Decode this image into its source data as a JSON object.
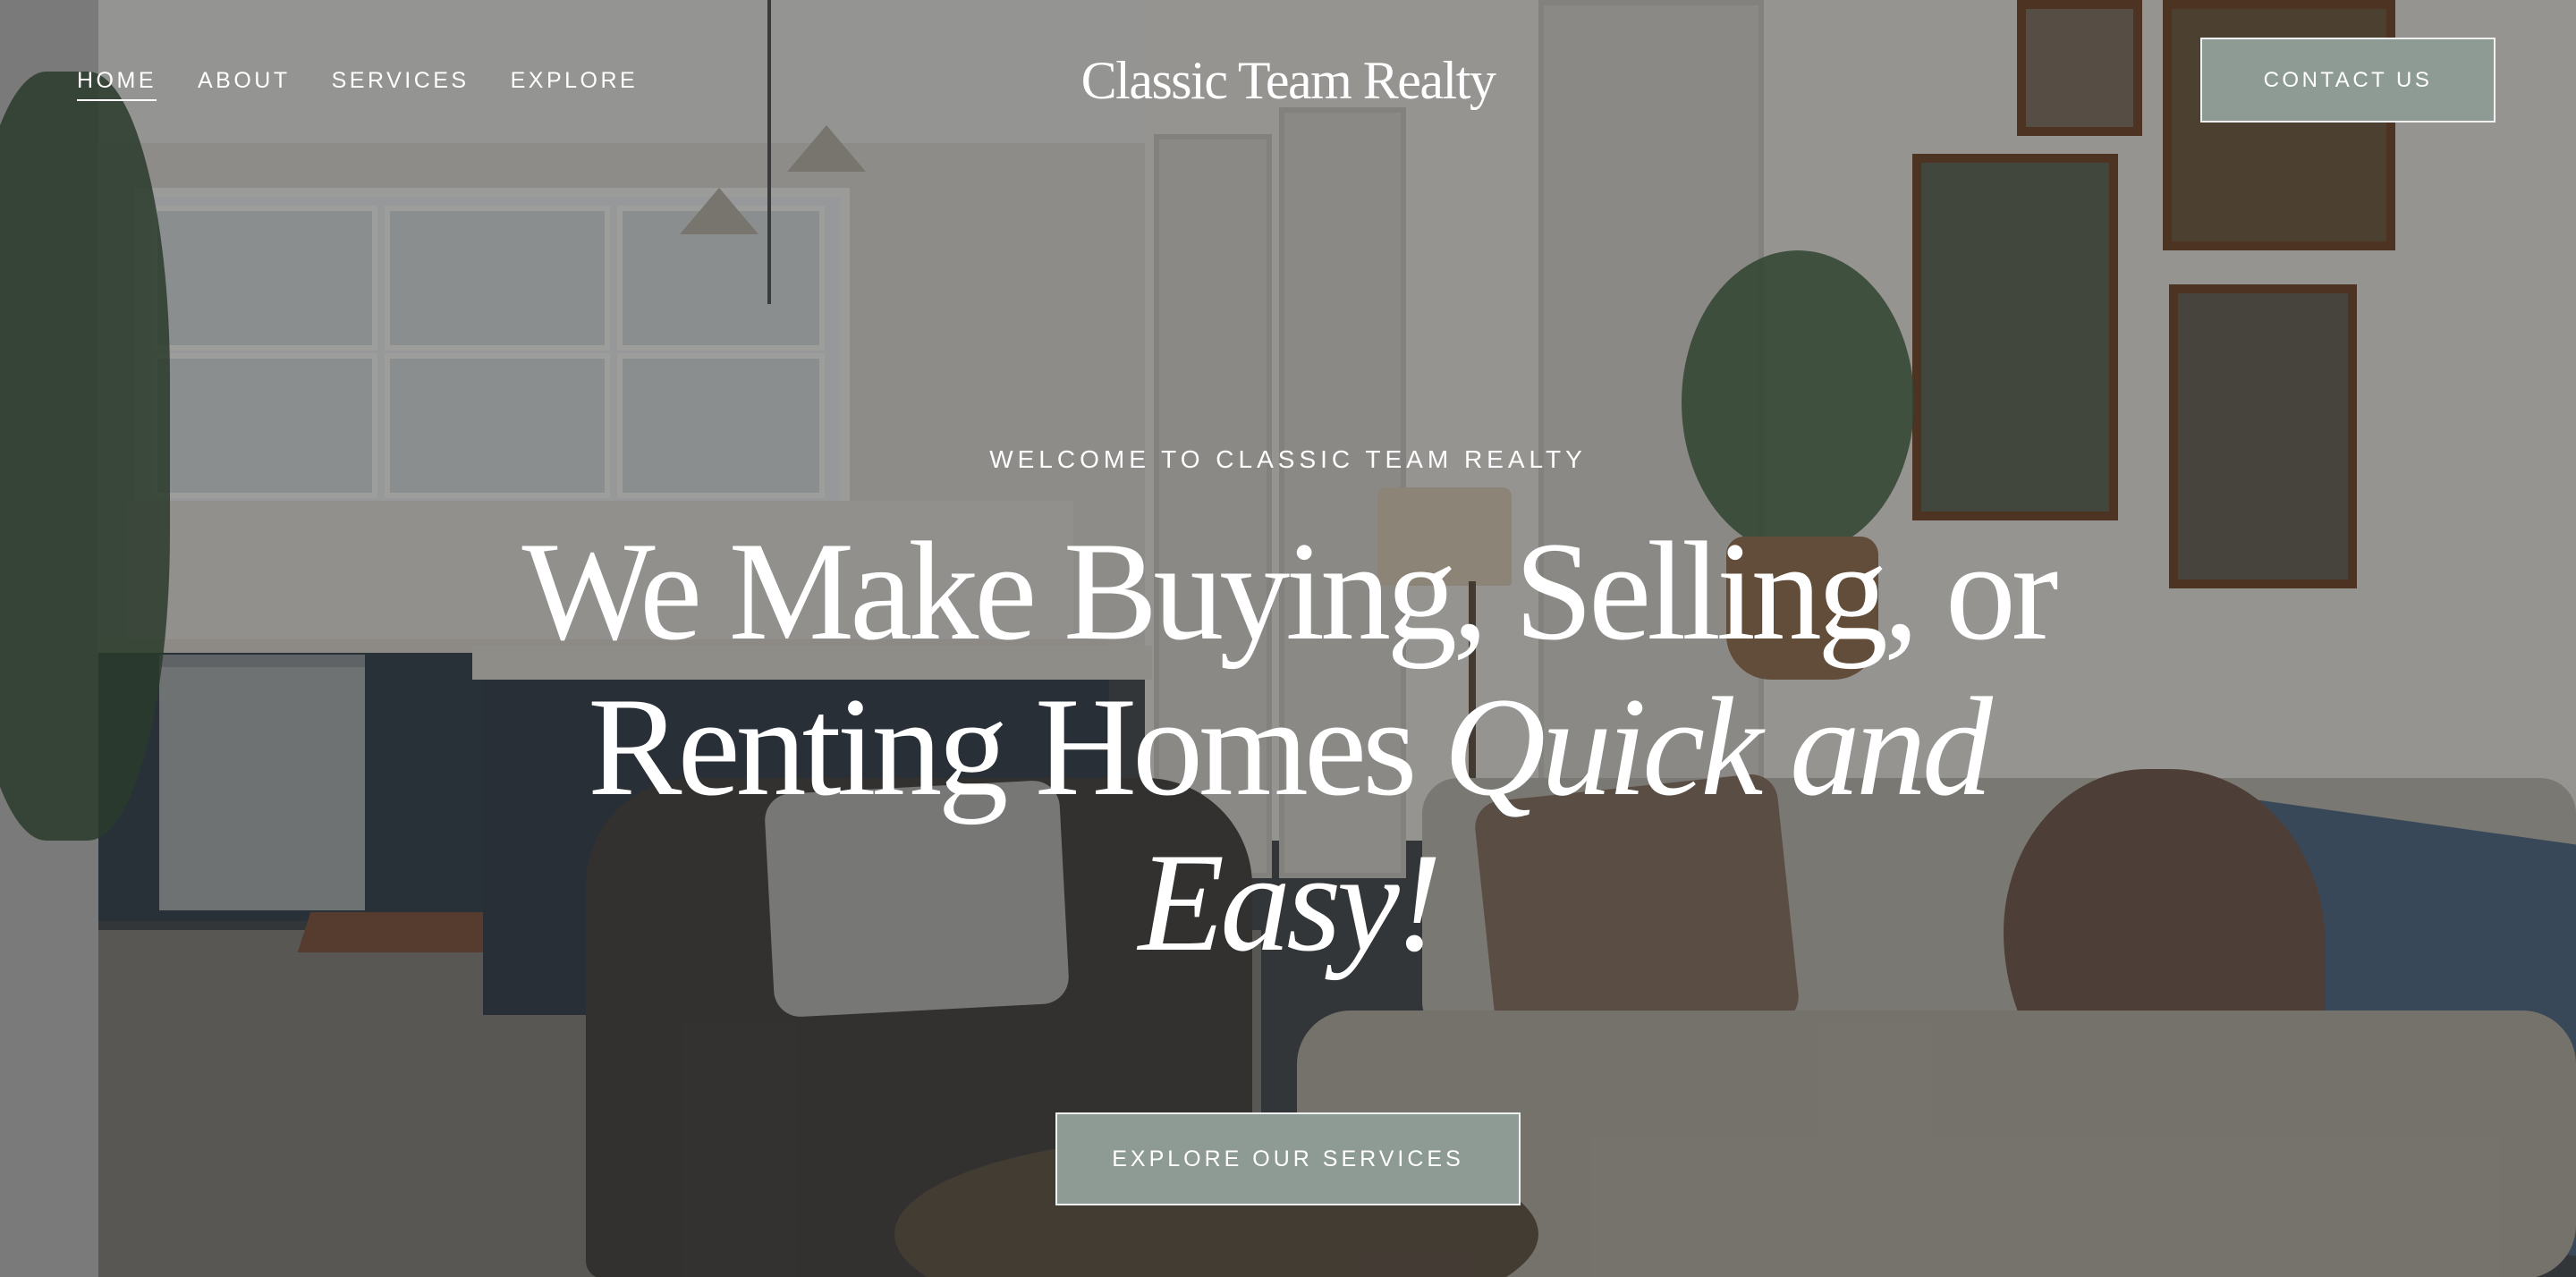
{
  "header": {
    "nav": [
      {
        "label": "HOME",
        "active": true
      },
      {
        "label": "ABOUT",
        "active": false
      },
      {
        "label": "SERVICES",
        "active": false
      },
      {
        "label": "EXPLORE",
        "active": false
      }
    ],
    "site_title": "Classic Team Realty",
    "contact_label": "CONTACT US"
  },
  "hero": {
    "eyebrow": "WELCOME TO CLASSIC TEAM REALTY",
    "headline_line1": "We Make Buying, Selling, or",
    "headline_line2_plain": "Renting Homes ",
    "headline_line2_italic": "Quick and",
    "headline_line3_italic": "Easy!",
    "cta_label": "EXPLORE OUR SERVICES"
  },
  "colors": {
    "button_fill": "#8e9b95",
    "button_border": "#eef1ef",
    "text": "#ffffff"
  }
}
